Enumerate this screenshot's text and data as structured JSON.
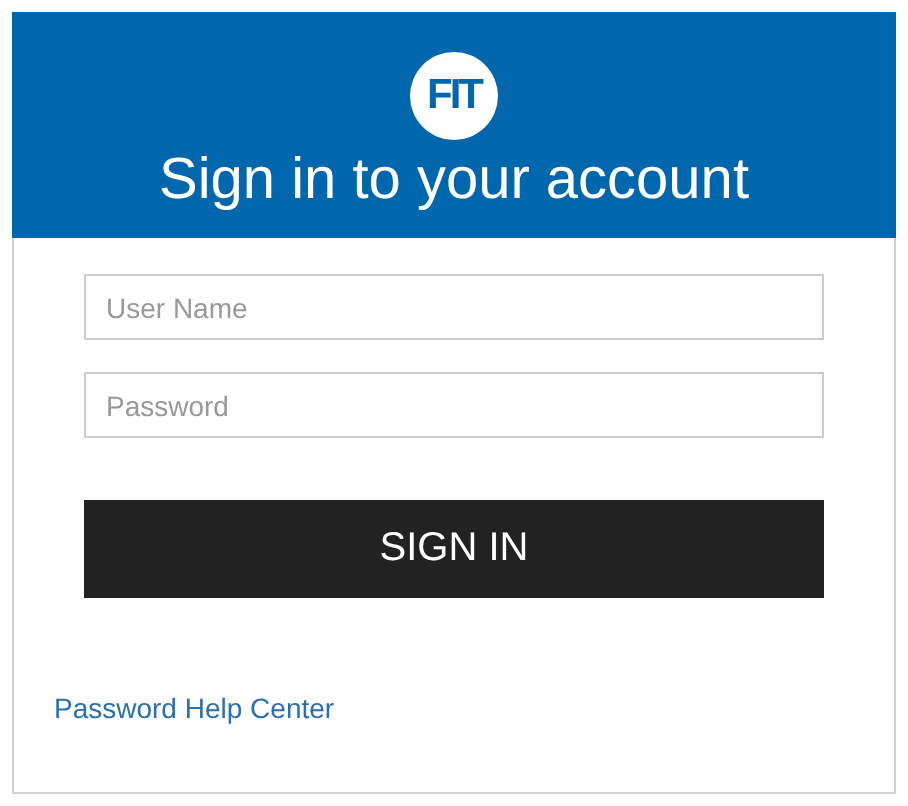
{
  "header": {
    "logo": "FIT",
    "title": "Sign in to your account"
  },
  "fields": [
    {
      "placeholder": "User Name"
    },
    {
      "placeholder": "Password"
    }
  ],
  "button": "SIGN IN",
  "link": "Password Help Center"
}
